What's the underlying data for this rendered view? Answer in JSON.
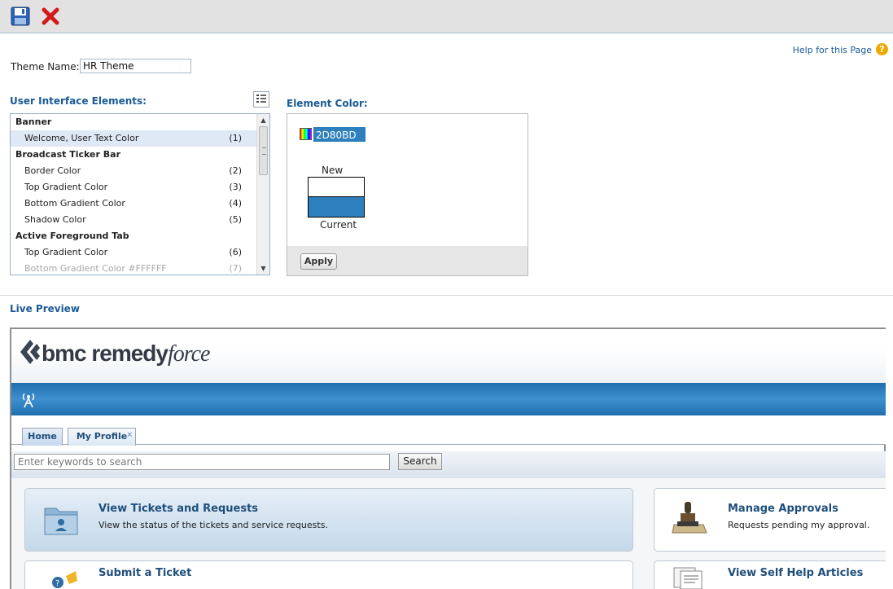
{
  "toolbar": {
    "save_icon": "save-icon",
    "cancel_icon": "close-icon"
  },
  "header": {
    "help_link": "Help for this Page",
    "help_icon": "?"
  },
  "theme": {
    "label": "Theme Name:",
    "value": "HR Theme"
  },
  "ui_elements": {
    "title": "User Interface Elements:",
    "rows": [
      {
        "label": "Banner",
        "type": "group",
        "num": ""
      },
      {
        "label": "Welcome, User Text Color",
        "type": "item",
        "num": "(1)",
        "selected": true
      },
      {
        "label": "Broadcast Ticker Bar",
        "type": "group",
        "num": ""
      },
      {
        "label": "Border Color",
        "type": "item",
        "num": "(2)"
      },
      {
        "label": "Top Gradient Color",
        "type": "item",
        "num": "(3)"
      },
      {
        "label": "Bottom Gradient Color",
        "type": "item",
        "num": "(4)"
      },
      {
        "label": "Shadow Color",
        "type": "item",
        "num": "(5)"
      },
      {
        "label": "Active Foreground Tab",
        "type": "group",
        "num": ""
      },
      {
        "label": "Top Gradient Color",
        "type": "item",
        "num": "(6)"
      },
      {
        "label": "Bottom Gradient Color  #FFFFFF",
        "type": "item",
        "num": "(7)",
        "disabled": true
      }
    ]
  },
  "element_color": {
    "title": "Element Color:",
    "hex": "2D80BD",
    "new_label": "New",
    "current_label": "Current",
    "new_color": "#FFFFFF",
    "current_color": "#2D80BD",
    "apply_label": "Apply"
  },
  "preview": {
    "title": "Live Preview",
    "logo_text": "bmc remedy",
    "logo_force": "force",
    "tabs": [
      "Home",
      "My Profile"
    ],
    "tab_close": "×",
    "search_placeholder": "Enter keywords to search",
    "search_button": "Search",
    "cards": [
      {
        "title": "View Tickets and Requests",
        "desc": "View the status of the tickets and service requests."
      },
      {
        "title": "Manage Approvals",
        "desc": "Requests pending my approval."
      },
      {
        "title": "Submit a Ticket",
        "desc": ""
      },
      {
        "title": "View Self Help Articles",
        "desc": ""
      }
    ]
  },
  "colors": {
    "accent": "#2D80BD",
    "link": "#1A5A96"
  }
}
